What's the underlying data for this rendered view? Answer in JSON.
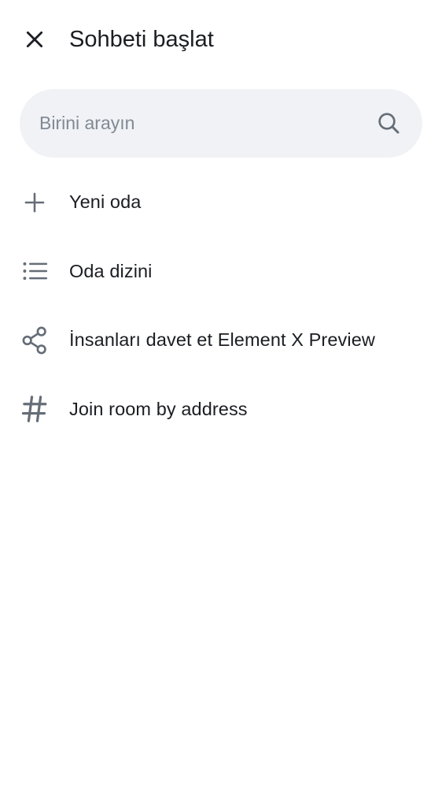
{
  "header": {
    "title": "Sohbeti başlat",
    "close_icon": "close-icon"
  },
  "search": {
    "placeholder": "Birini arayın",
    "value": "",
    "icon": "search-icon"
  },
  "menu": {
    "items": [
      {
        "label": "Yeni oda",
        "icon": "plus-icon"
      },
      {
        "label": "Oda dizini",
        "icon": "list-icon"
      },
      {
        "label": "İnsanları davet et Element X Preview",
        "icon": "share-icon"
      },
      {
        "label": "Join room by address",
        "icon": "hash-icon"
      }
    ]
  },
  "colors": {
    "background": "#ffffff",
    "text_primary": "#1b1d22",
    "icon_gray": "#656d77",
    "search_bg": "#f0f2f5",
    "placeholder": "#818a95"
  }
}
